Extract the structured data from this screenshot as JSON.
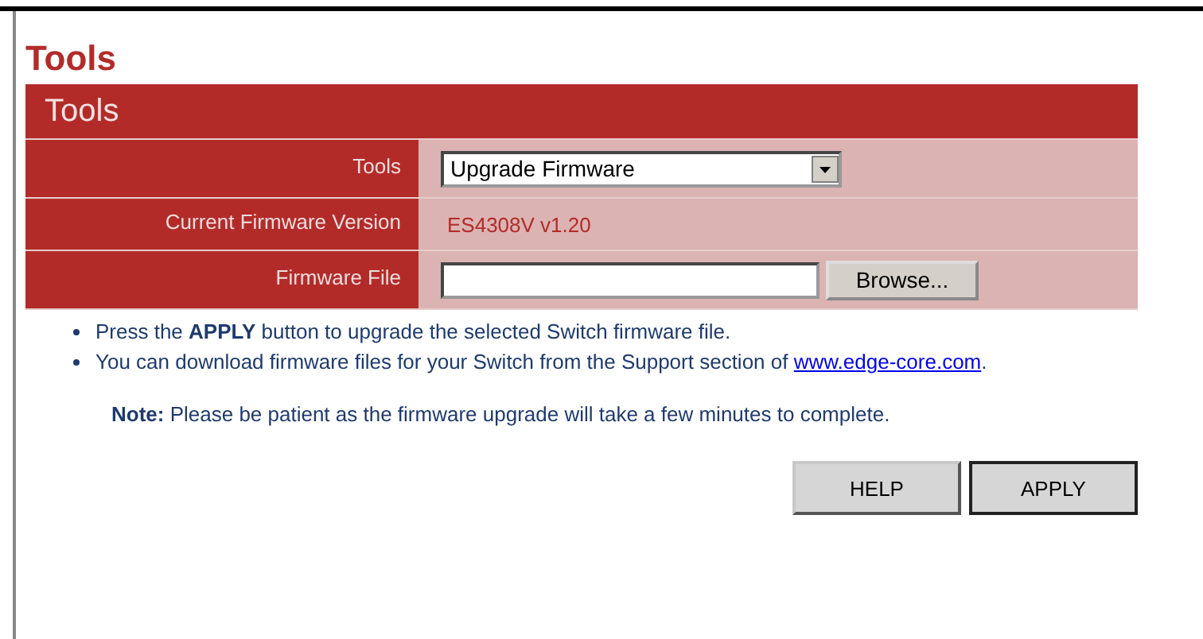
{
  "page_title": "Tools",
  "panel": {
    "title": "Tools",
    "rows": [
      {
        "kind": "select",
        "label": "Tools",
        "value": "Upgrade Firmware"
      },
      {
        "kind": "text",
        "label": "Current Firmware Version",
        "value": "ES4308V v1.20"
      },
      {
        "kind": "file",
        "label": "Firmware File",
        "button": "Browse..."
      }
    ]
  },
  "notes": [
    {
      "text": "Press the **APPLY** button to upgrade the selected Switch firmware file."
    },
    {
      "text": "You can download firmware files for your Switch from the Support section of ",
      "link": "www.edge-core.com",
      "after": "."
    }
  ],
  "note": "**Note:** Please be patient as the firmware upgrade will take a few minutes to complete.",
  "buttons": [
    {
      "label": "HELP",
      "kind": "help"
    },
    {
      "label": "APPLY",
      "kind": "apply"
    }
  ]
}
